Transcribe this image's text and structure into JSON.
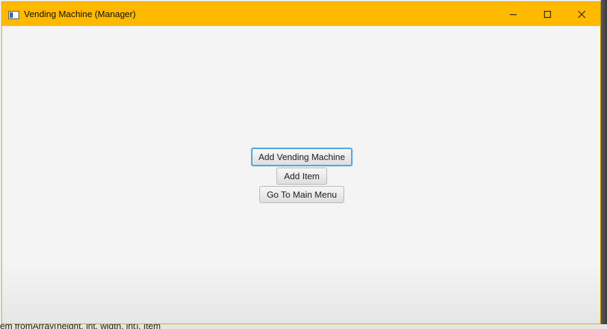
{
  "window": {
    "title": "Vending Machine (Manager)"
  },
  "buttons": {
    "add_vending_machine": "Add Vending Machine",
    "add_item": "Add Item",
    "main_menu": "Go To Main Menu"
  },
  "background": {
    "code_snippet": "em fromArray(height, int, width, int), Item"
  },
  "colors": {
    "titlebar": "#ffb900",
    "focus_ring": "#4fa6d8"
  }
}
